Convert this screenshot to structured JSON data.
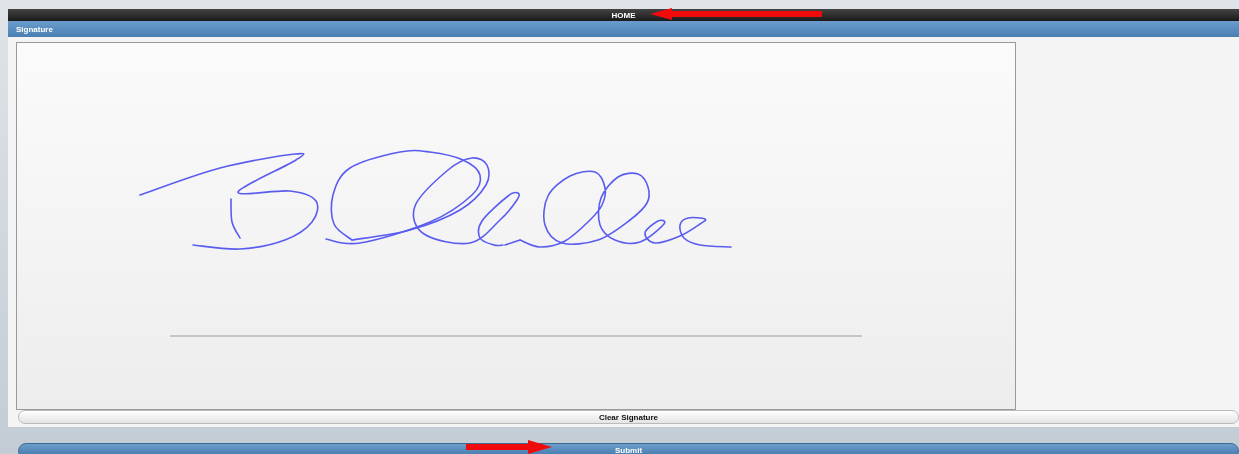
{
  "header": {
    "title": "HOME"
  },
  "section": {
    "title": "Signature"
  },
  "buttons": [
    {
      "label": "Clear Signature",
      "kind": "secondary"
    },
    {
      "label": "Submit",
      "kind": "primary"
    }
  ]
}
